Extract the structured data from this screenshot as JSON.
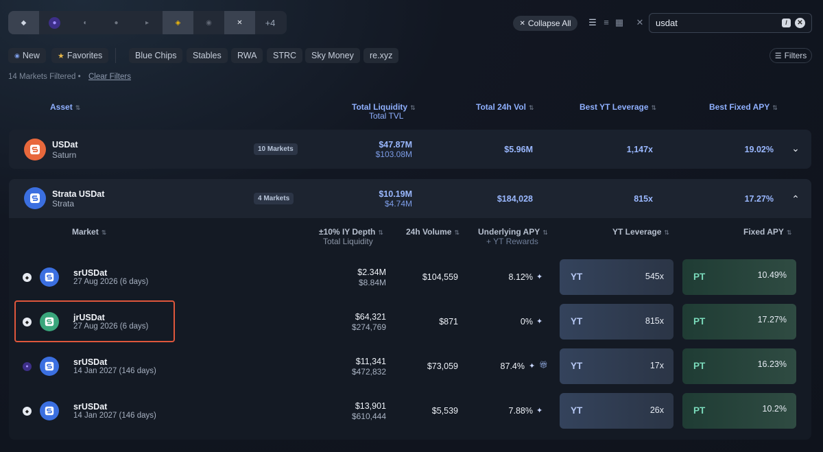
{
  "chains": {
    "more": "+4",
    "items": [
      {
        "name": "ethereum-icon",
        "glyph": "◆",
        "color": "#cfd6e2"
      },
      {
        "name": "strata-chain-icon",
        "glyph": "●",
        "color": "#8a6cff"
      },
      {
        "name": "chain-3-icon",
        "glyph": "◐",
        "color": "#7b8391"
      },
      {
        "name": "chain-4-icon",
        "glyph": "●",
        "color": "#6e7581"
      },
      {
        "name": "chain-5-icon",
        "glyph": "▸",
        "color": "#6e7581"
      },
      {
        "name": "bnb-icon",
        "glyph": "◈",
        "color": "#f0b90b"
      },
      {
        "name": "chain-7-icon",
        "glyph": "◉",
        "color": "#5f6673"
      },
      {
        "name": "chain-8-icon",
        "glyph": "✕",
        "color": "#e8ecf3"
      }
    ]
  },
  "toolbar": {
    "collapse_all": "Collapse All",
    "search_value": "usdat",
    "search_shortcut": "/"
  },
  "filters": {
    "new": "New",
    "favorites": "Favorites",
    "chips": [
      "Blue Chips",
      "Stables",
      "RWA",
      "STRC",
      "Sky Money",
      "re.xyz"
    ],
    "filters_btn": "Filters",
    "count_text": "14 Markets Filtered",
    "bullet": "•",
    "clear": "Clear Filters"
  },
  "columns": {
    "asset": "Asset",
    "total_liquidity": "Total Liquidity",
    "total_tvl": "Total TVL",
    "vol": "Total 24h Vol",
    "yt_leverage": "Best YT Leverage",
    "fixed_apy": "Best Fixed APY"
  },
  "assets": [
    {
      "name": "USDat",
      "issuer": "Saturn",
      "markets": "10 Markets",
      "liquidity": "$47.87M",
      "tvl": "$103.08M",
      "vol": "$5.96M",
      "leverage": "1,147x",
      "apy": "19.02%",
      "color": "#e8683c"
    },
    {
      "name": "Strata USDat",
      "issuer": "Strata",
      "markets": "4 Markets",
      "liquidity": "$10.19M",
      "tvl": "$4.74M",
      "vol": "$184,028",
      "leverage": "815x",
      "apy": "17.27%",
      "color": "#3b6fe0"
    }
  ],
  "sub_columns": {
    "market": "Market",
    "depth": "±10% IY Depth",
    "depth_sub": "Total Liquidity",
    "volume": "24h Volume",
    "underlying": "Underlying APY",
    "underlying_sub": "+ YT Rewards",
    "yt_leverage": "YT Leverage",
    "fixed_apy": "Fixed APY"
  },
  "markets": [
    {
      "name": "srUSDat",
      "date": "27 Aug 2026 (6 days)",
      "depth": "$2.34M",
      "liquidity": "$8.84M",
      "volume": "$104,559",
      "underlying": "8.12%",
      "yt_label": "YT",
      "yt": "545x",
      "pt_label": "PT",
      "pt": "10.49%",
      "color": "#3b6fe0",
      "chain": "ethereum"
    },
    {
      "name": "jrUSDat",
      "date": "27 Aug 2026 (6 days)",
      "depth": "$64,321",
      "liquidity": "$274,769",
      "volume": "$871",
      "underlying": "0%",
      "yt_label": "YT",
      "yt": "815x",
      "pt_label": "PT",
      "pt": "17.27%",
      "color": "#3aa67c",
      "chain": "ethereum"
    },
    {
      "name": "srUSDat",
      "date": "14 Jan 2027 (146 days)",
      "depth": "$11,341",
      "liquidity": "$472,832",
      "volume": "$73,059",
      "underlying": "87.4%",
      "yt_label": "YT",
      "yt": "17x",
      "pt_label": "PT",
      "pt": "16.23%",
      "color": "#3b6fe0",
      "chain": "strata"
    },
    {
      "name": "srUSDat",
      "date": "14 Jan 2027 (146 days)",
      "depth": "$13,901",
      "liquidity": "$610,444",
      "volume": "$5,539",
      "underlying": "7.88%",
      "yt_label": "YT",
      "yt": "26x",
      "pt_label": "PT",
      "pt": "10.2%",
      "color": "#3b6fe0",
      "chain": "ethereum"
    }
  ]
}
